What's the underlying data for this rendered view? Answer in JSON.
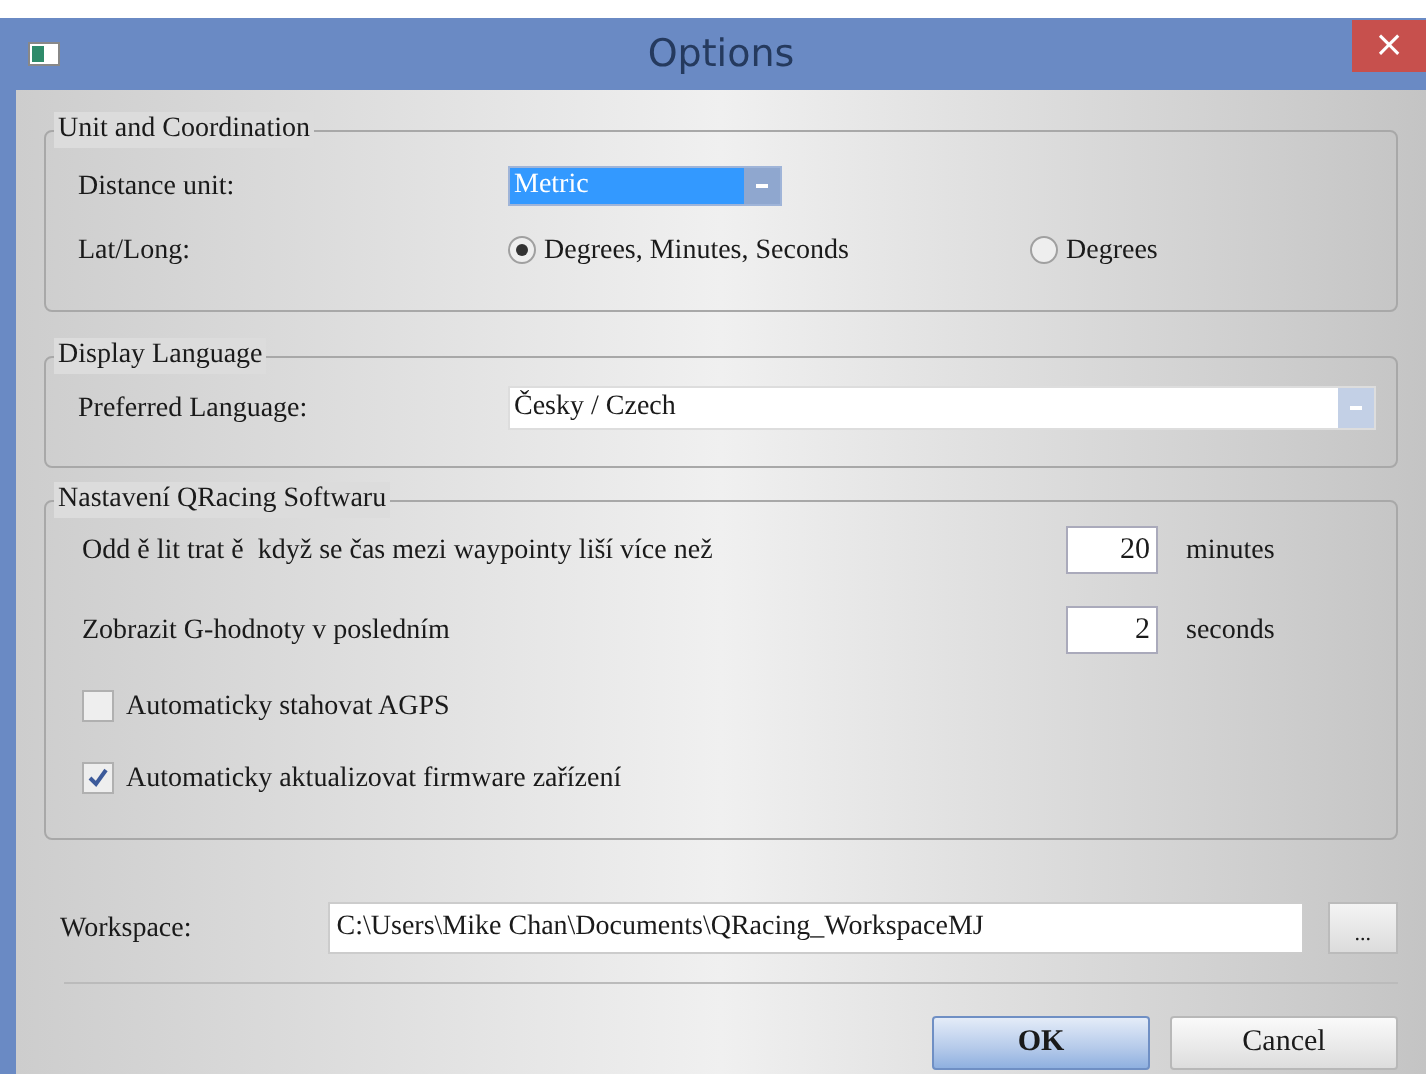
{
  "window": {
    "title": "Options",
    "close": "×"
  },
  "unit_group": {
    "title": "Unit and Coordination",
    "distance_label": "Distance unit:",
    "distance_value": "Metric",
    "distance_focused": true,
    "latlong_label": "Lat/Long:",
    "latlong_options": [
      {
        "label": "Degrees, Minutes, Seconds",
        "selected": true
      },
      {
        "label": "Degrees",
        "selected": false
      }
    ]
  },
  "language_group": {
    "title": "Display Language",
    "label": "Preferred Language:",
    "value": "Česky / Czech"
  },
  "software_group": {
    "title": "Nastavení QRacing Softwaru",
    "number_rows": [
      {
        "label": "Odd ě lit trat ě  když se čas mezi waypointy liší více než",
        "value": "20",
        "unit": "minutes"
      },
      {
        "label": "Zobrazit G-hodnoty v posledním",
        "value": "2",
        "unit": "seconds"
      }
    ],
    "checkboxes": [
      {
        "label": "Automaticky stahovat AGPS",
        "checked": false
      },
      {
        "label": "Automaticky aktualizovat firmware zařízení",
        "checked": true
      }
    ]
  },
  "workspace": {
    "label": "Workspace:",
    "value": "C:\\Users\\Mike Chan\\Documents\\QRacing_WorkspaceMJ",
    "browse": "..."
  },
  "buttons": [
    {
      "label": "OK",
      "kind": "default"
    },
    {
      "label": "Cancel",
      "kind": "normal"
    }
  ]
}
